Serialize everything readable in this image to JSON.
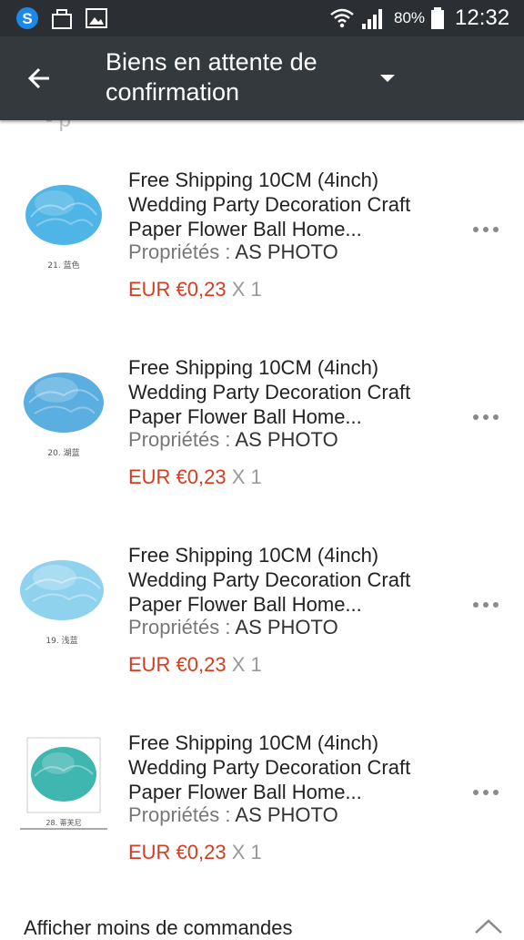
{
  "status_bar": {
    "battery_percent": "80%",
    "time": "12:32",
    "icons": [
      "skype-icon",
      "store-icon",
      "gallery-icon",
      "wifi-icon",
      "signal-icon",
      "battery-icon"
    ]
  },
  "app_bar": {
    "title_line1": "Biens en attente de",
    "title_line2": "confirmation",
    "back_icon": "arrow-left-icon",
    "dropdown_icon": "caret-down-icon"
  },
  "items": [
    {
      "thumb_caption": "21. 蓝色",
      "thumb_color": "#4fb5e6",
      "name_line1": "Free Shipping 10CM (4inch)",
      "name_line2": "Wedding Party Decoration Craft",
      "name_line3": "Paper Flower Ball Home...",
      "props_label": "Propriétés :",
      "props_value": "AS PHOTO",
      "price": "EUR €0,23",
      "qty": "X 1"
    },
    {
      "thumb_caption": "20. 湖蓝",
      "thumb_color": "#5aaee0",
      "name_line1": "Free Shipping 10CM (4inch)",
      "name_line2": "Wedding Party Decoration Craft",
      "name_line3": "Paper Flower Ball Home...",
      "props_label": "Propriétés :",
      "props_value": "AS PHOTO",
      "price": "EUR €0,23",
      "qty": "X 1"
    },
    {
      "thumb_caption": "19. 浅蓝",
      "thumb_color": "#8fd2ee",
      "name_line1": "Free Shipping 10CM (4inch)",
      "name_line2": "Wedding Party Decoration Craft",
      "name_line3": "Paper Flower Ball Home...",
      "props_label": "Propriétés :",
      "props_value": "AS PHOTO",
      "price": "EUR €0,23",
      "qty": "X 1"
    },
    {
      "thumb_caption": "28. 蒂芙尼",
      "thumb_color": "#3fb6b0",
      "name_line1": "Free Shipping 10CM (4inch)",
      "name_line2": "Wedding Party Decoration Craft",
      "name_line3": "Paper Flower Ball Home...",
      "props_label": "Propriétés :",
      "props_value": "AS PHOTO",
      "price": "EUR €0,23",
      "qty": "X 1"
    }
  ],
  "footer": {
    "label": "Afficher moins de commandes",
    "icon": "chevron-up-icon"
  },
  "colors": {
    "app_bar": "#34393e",
    "status_bar": "#2b2f33",
    "price": "#d93b1e"
  }
}
